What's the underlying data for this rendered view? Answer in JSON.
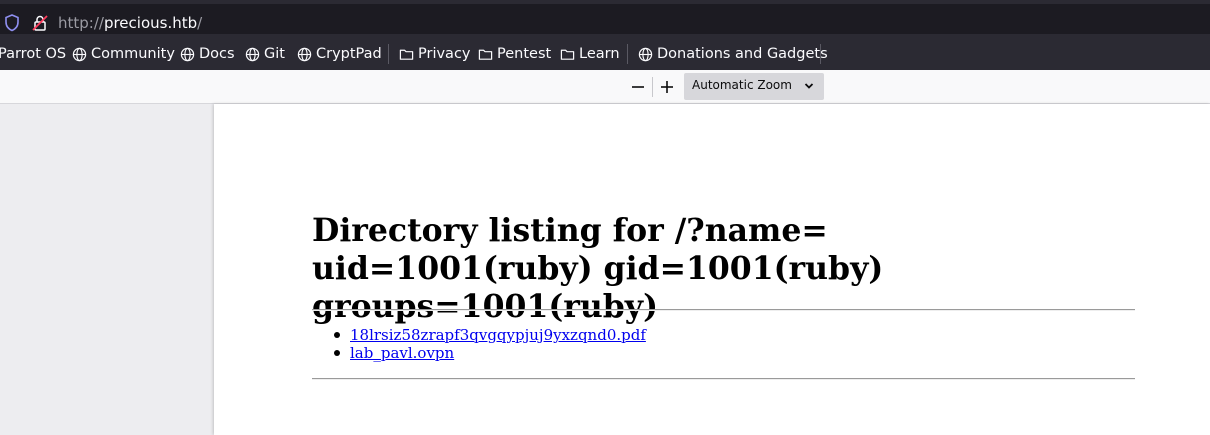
{
  "browser": {
    "url_protocol": "http://",
    "url_host": "precious.htb",
    "url_trailing": "/"
  },
  "bookmarks": [
    {
      "label": "Parrot OS",
      "icon": "none"
    },
    {
      "label": "Community",
      "icon": "globe-icon"
    },
    {
      "label": "Docs",
      "icon": "globe-icon"
    },
    {
      "label": "Git",
      "icon": "globe-icon"
    },
    {
      "label": "CryptPad",
      "icon": "globe-icon"
    },
    {
      "label": "Privacy",
      "icon": "folder-icon"
    },
    {
      "label": "Pentest",
      "icon": "folder-icon"
    },
    {
      "label": "Learn",
      "icon": "folder-icon"
    },
    {
      "label": "Donations and Gadgets",
      "icon": "globe-icon"
    }
  ],
  "pdf_toolbar": {
    "zoom_value": "Automatic Zoom"
  },
  "document": {
    "heading": "Directory listing for /?name= uid=1001(ruby) gid=1001(ruby) groups=1001(ruby)",
    "files": [
      "18lrsiz58zrapf3qvgqypjuj9yxzqnd0.pdf",
      "lab_pavl.ovpn"
    ]
  }
}
